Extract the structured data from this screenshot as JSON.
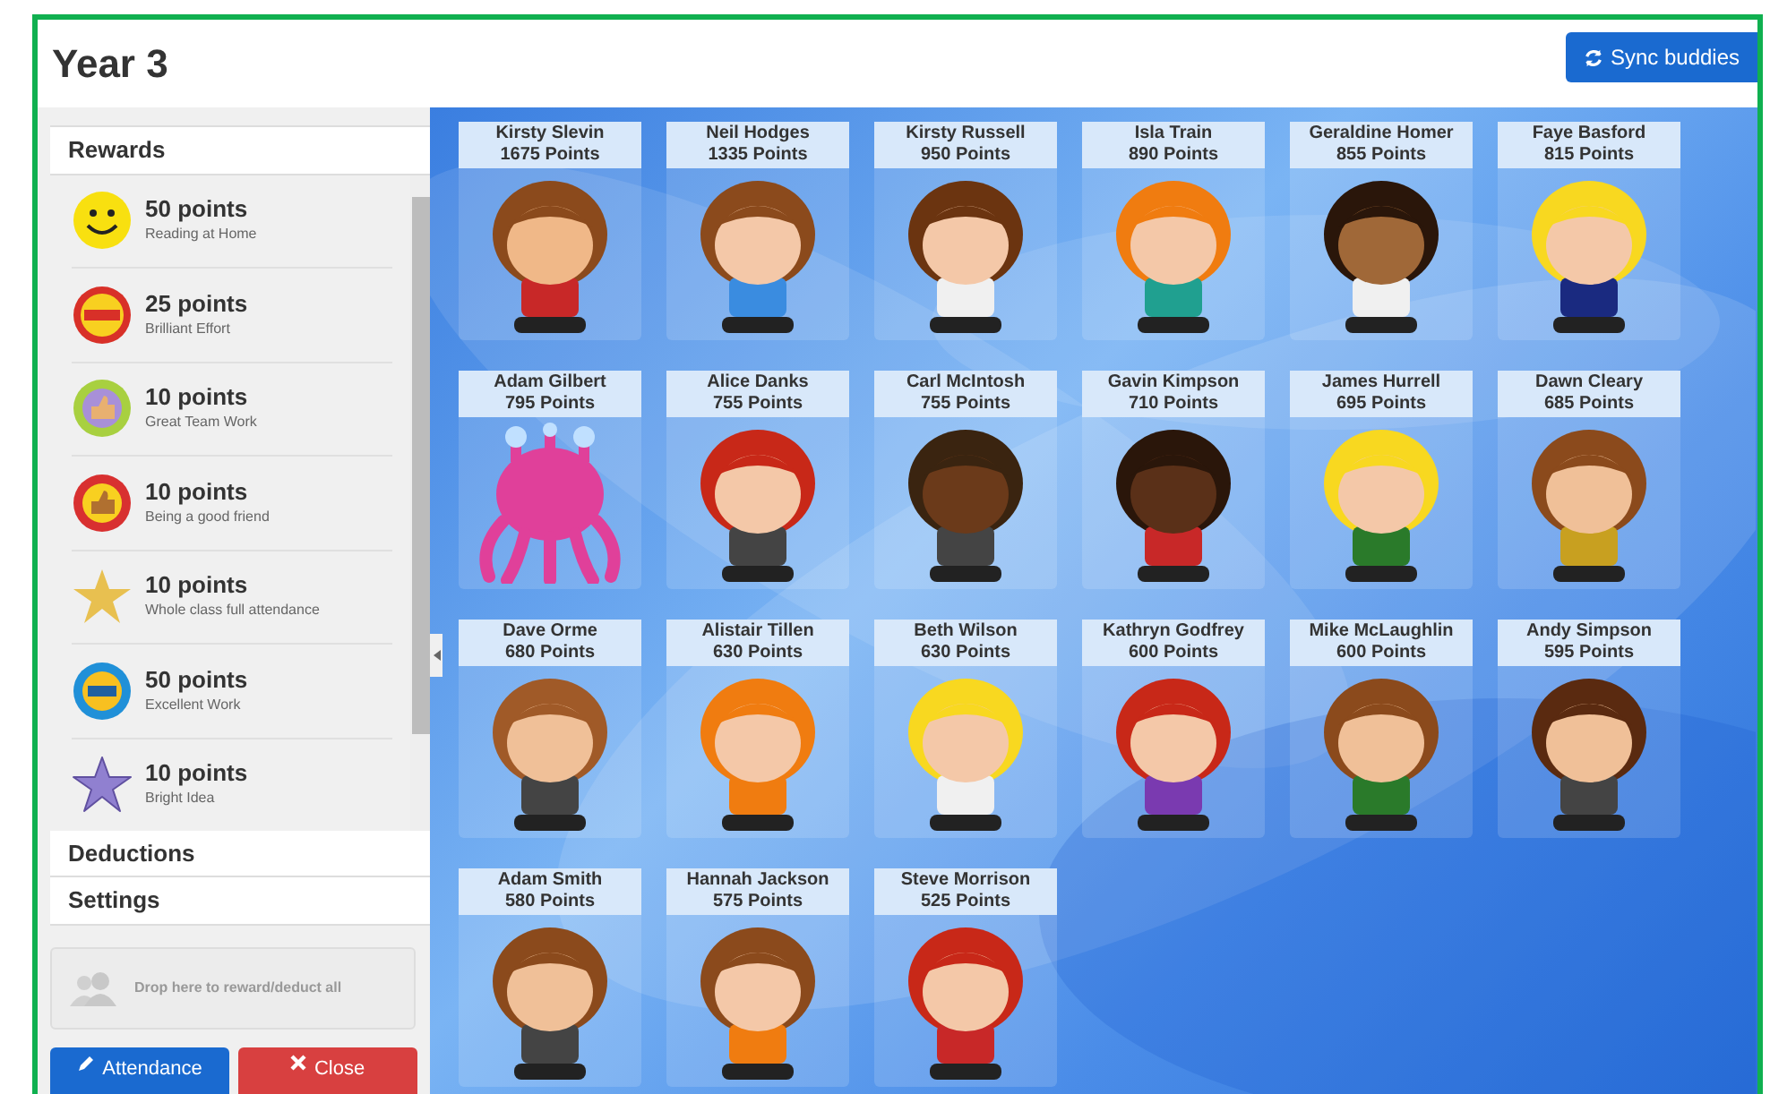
{
  "title": "Year 3",
  "sync_button": {
    "label": "Sync buddies"
  },
  "sidebar": {
    "sections": [
      {
        "label": "Rewards",
        "expanded": true
      },
      {
        "label": "Deductions",
        "expanded": false
      },
      {
        "label": "Settings",
        "expanded": false
      }
    ],
    "rewards": [
      {
        "points": "50 points",
        "name": "Reading at Home"
      },
      {
        "points": "25 points",
        "name": "Brilliant Effort"
      },
      {
        "points": "10 points",
        "name": "Great Team Work"
      },
      {
        "points": "10 points",
        "name": "Being a good friend"
      },
      {
        "points": "10 points",
        "name": "Whole class full attendance"
      },
      {
        "points": "50 points",
        "name": "Excellent Work"
      },
      {
        "points": "10 points",
        "name": "Bright Idea"
      }
    ],
    "drop_zone": {
      "text": "Drop here to reward/deduct all"
    },
    "buttons": [
      {
        "kind": "primary",
        "label": "Attendance"
      },
      {
        "kind": "danger",
        "label": "Close"
      }
    ]
  },
  "students": [
    {
      "name": "Kirsty Slevin",
      "points": "1675 Points",
      "kind": "child"
    },
    {
      "name": "Neil Hodges",
      "points": "1335 Points",
      "kind": "child"
    },
    {
      "name": "Kirsty Russell",
      "points": "950 Points",
      "kind": "child"
    },
    {
      "name": "Isla Train",
      "points": "890 Points",
      "kind": "child"
    },
    {
      "name": "Geraldine Homer",
      "points": "855 Points",
      "kind": "child"
    },
    {
      "name": "Faye Basford",
      "points": "815 Points",
      "kind": "child"
    },
    {
      "name": "Adam Gilbert",
      "points": "795 Points",
      "kind": "monster"
    },
    {
      "name": "Alice Danks",
      "points": "755 Points",
      "kind": "child"
    },
    {
      "name": "Carl McIntosh",
      "points": "755 Points",
      "kind": "child"
    },
    {
      "name": "Gavin Kimpson",
      "points": "710 Points",
      "kind": "child"
    },
    {
      "name": "James Hurrell",
      "points": "695 Points",
      "kind": "child"
    },
    {
      "name": "Dawn Cleary",
      "points": "685 Points",
      "kind": "child"
    },
    {
      "name": "Dave Orme",
      "points": "680 Points",
      "kind": "child"
    },
    {
      "name": "Alistair Tillen",
      "points": "630 Points",
      "kind": "child"
    },
    {
      "name": "Beth Wilson",
      "points": "630 Points",
      "kind": "child"
    },
    {
      "name": "Kathryn Godfrey",
      "points": "600 Points",
      "kind": "child"
    },
    {
      "name": "Mike McLaughlin",
      "points": "600 Points",
      "kind": "child"
    },
    {
      "name": "Andy Simpson",
      "points": "595 Points",
      "kind": "child"
    },
    {
      "name": "Adam Smith",
      "points": "580 Points",
      "kind": "child"
    },
    {
      "name": "Hannah Jackson",
      "points": "575 Points",
      "kind": "child"
    },
    {
      "name": "Steve Morrison",
      "points": "525 Points",
      "kind": "child"
    }
  ]
}
